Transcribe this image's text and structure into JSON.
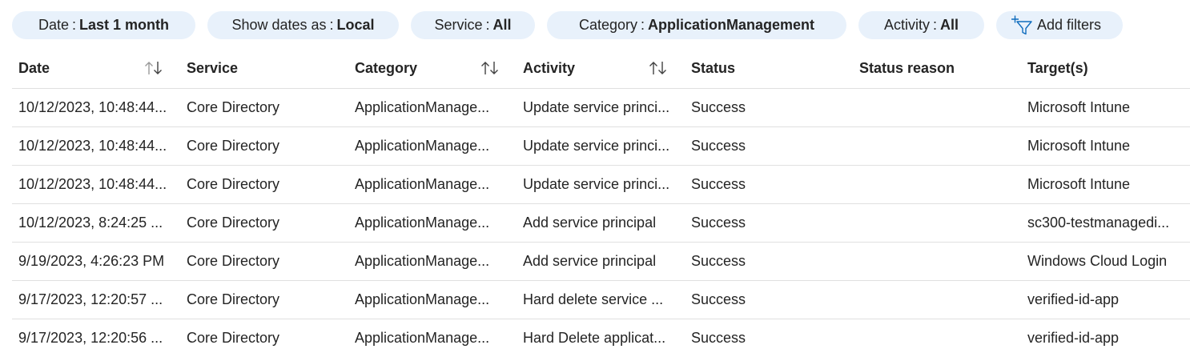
{
  "filters": [
    {
      "label": "Date",
      "sep": ":",
      "value": "Last 1 month"
    },
    {
      "label": "Show dates as",
      "sep": ":",
      "value": "Local"
    },
    {
      "label": "Service",
      "sep": ":",
      "value": "All"
    },
    {
      "label": "Category",
      "sep": ":",
      "value": "ApplicationManagement"
    },
    {
      "label": "Activity",
      "sep": ":",
      "value": "All"
    }
  ],
  "add_filters_label": "Add filters",
  "icons": {
    "add_filter": "add-filter-icon",
    "sort": "sort-arrows-icon"
  },
  "columns": [
    "Date",
    "Service",
    "Category",
    "Activity",
    "Status",
    "Status reason",
    "Target(s)"
  ],
  "rows": [
    [
      "10/12/2023, 10:48:44...",
      "Core Directory",
      "ApplicationManage...",
      "Update service princi...",
      "Success",
      "",
      "Microsoft Intune"
    ],
    [
      "10/12/2023, 10:48:44...",
      "Core Directory",
      "ApplicationManage...",
      "Update service princi...",
      "Success",
      "",
      "Microsoft Intune"
    ],
    [
      "10/12/2023, 10:48:44...",
      "Core Directory",
      "ApplicationManage...",
      "Update service princi...",
      "Success",
      "",
      "Microsoft Intune"
    ],
    [
      "10/12/2023, 8:24:25 ...",
      "Core Directory",
      "ApplicationManage...",
      "Add service principal",
      "Success",
      "",
      "sc300-testmanagedi..."
    ],
    [
      "9/19/2023, 4:26:23 PM",
      "Core Directory",
      "ApplicationManage...",
      "Add service principal",
      "Success",
      "",
      "Windows Cloud Login"
    ],
    [
      "9/17/2023, 12:20:57 ...",
      "Core Directory",
      "ApplicationManage...",
      "Hard delete service ...",
      "Success",
      "",
      "verified-id-app"
    ],
    [
      "9/17/2023, 12:20:56 ...",
      "Core Directory",
      "ApplicationManage...",
      "Hard Delete applicat...",
      "Success",
      "",
      "verified-id-app"
    ]
  ],
  "colors": {
    "pill_bg": "#e8f1fb",
    "accent": "#0f6cbd",
    "divider": "#e0e0e0",
    "text": "#242424"
  }
}
